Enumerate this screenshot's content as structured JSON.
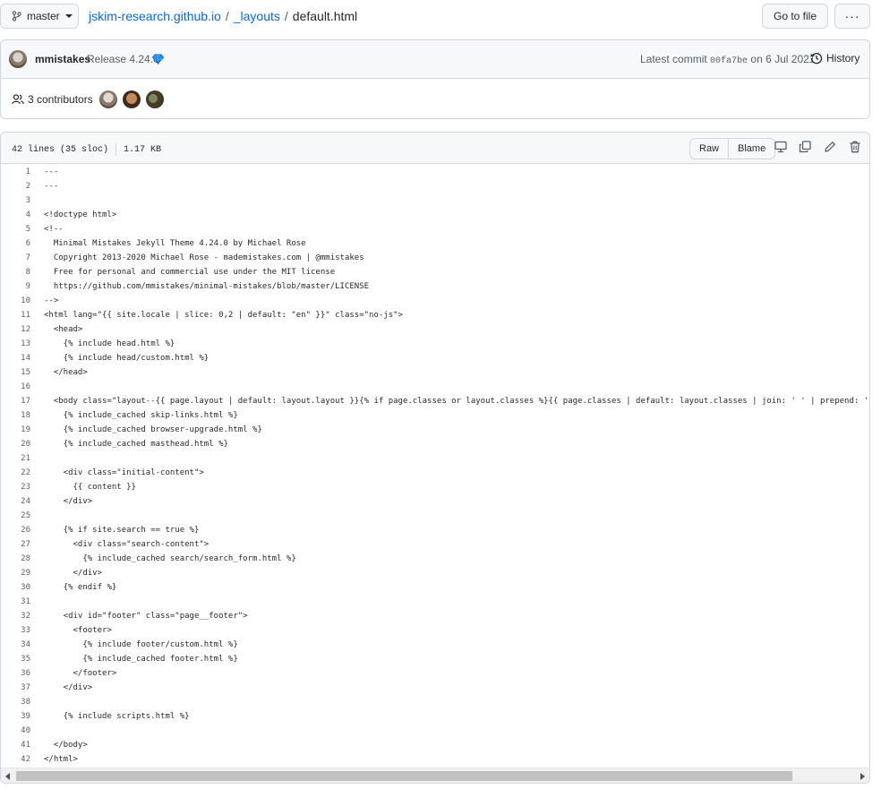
{
  "topbar": {
    "branch": "master",
    "repo": "jskim-research.github.io",
    "folder": "_layouts",
    "file": "default.html",
    "sep": "/",
    "goto_label": "Go to file",
    "more_label": "···"
  },
  "commit": {
    "author": "mmistakes",
    "message": "Release 4.24.0",
    "latest_prefix": "Latest commit",
    "sha": "00fa7be",
    "date_text": "on 6 Jul 2021",
    "history_label": "History"
  },
  "contributors": {
    "label": "3 contributors"
  },
  "file": {
    "lines_info": "42 lines (35 sloc)",
    "size": "1.17 KB",
    "raw_label": "Raw",
    "blame_label": "Blame"
  },
  "code_lines": [
    "---",
    "---",
    "",
    "<!doctype html>",
    "<!--",
    "  Minimal Mistakes Jekyll Theme 4.24.0 by Michael Rose",
    "  Copyright 2013-2020 Michael Rose - mademistakes.com | @mmistakes",
    "  Free for personal and commercial use under the MIT license",
    "  https://github.com/mmistakes/minimal-mistakes/blob/master/LICENSE",
    "-->",
    "<html lang=\"{{ site.locale | slice: 0,2 | default: \"en\" }}\" class=\"no-js\">",
    "  <head>",
    "    {% include head.html %}",
    "    {% include head/custom.html %}",
    "  </head>",
    "",
    "  <body class=\"layout--{{ page.layout | default: layout.layout }}{% if page.classes or layout.classes %}{{ page.classes | default: layout.classes | join: ' ' | prepend: ' ' }}",
    "    {% include_cached skip-links.html %}",
    "    {% include_cached browser-upgrade.html %}",
    "    {% include_cached masthead.html %}",
    "",
    "    <div class=\"initial-content\">",
    "      {{ content }}",
    "    </div>",
    "",
    "    {% if site.search == true %}",
    "      <div class=\"search-content\">",
    "        {% include_cached search/search_form.html %}",
    "      </div>",
    "    {% endif %}",
    "",
    "    <div id=\"footer\" class=\"page__footer\">",
    "      <footer>",
    "        {% include footer/custom.html %}",
    "        {% include_cached footer.html %}",
    "      </footer>",
    "    </div>",
    "",
    "    {% include scripts.html %}",
    "",
    "  </body>",
    "</html>"
  ]
}
